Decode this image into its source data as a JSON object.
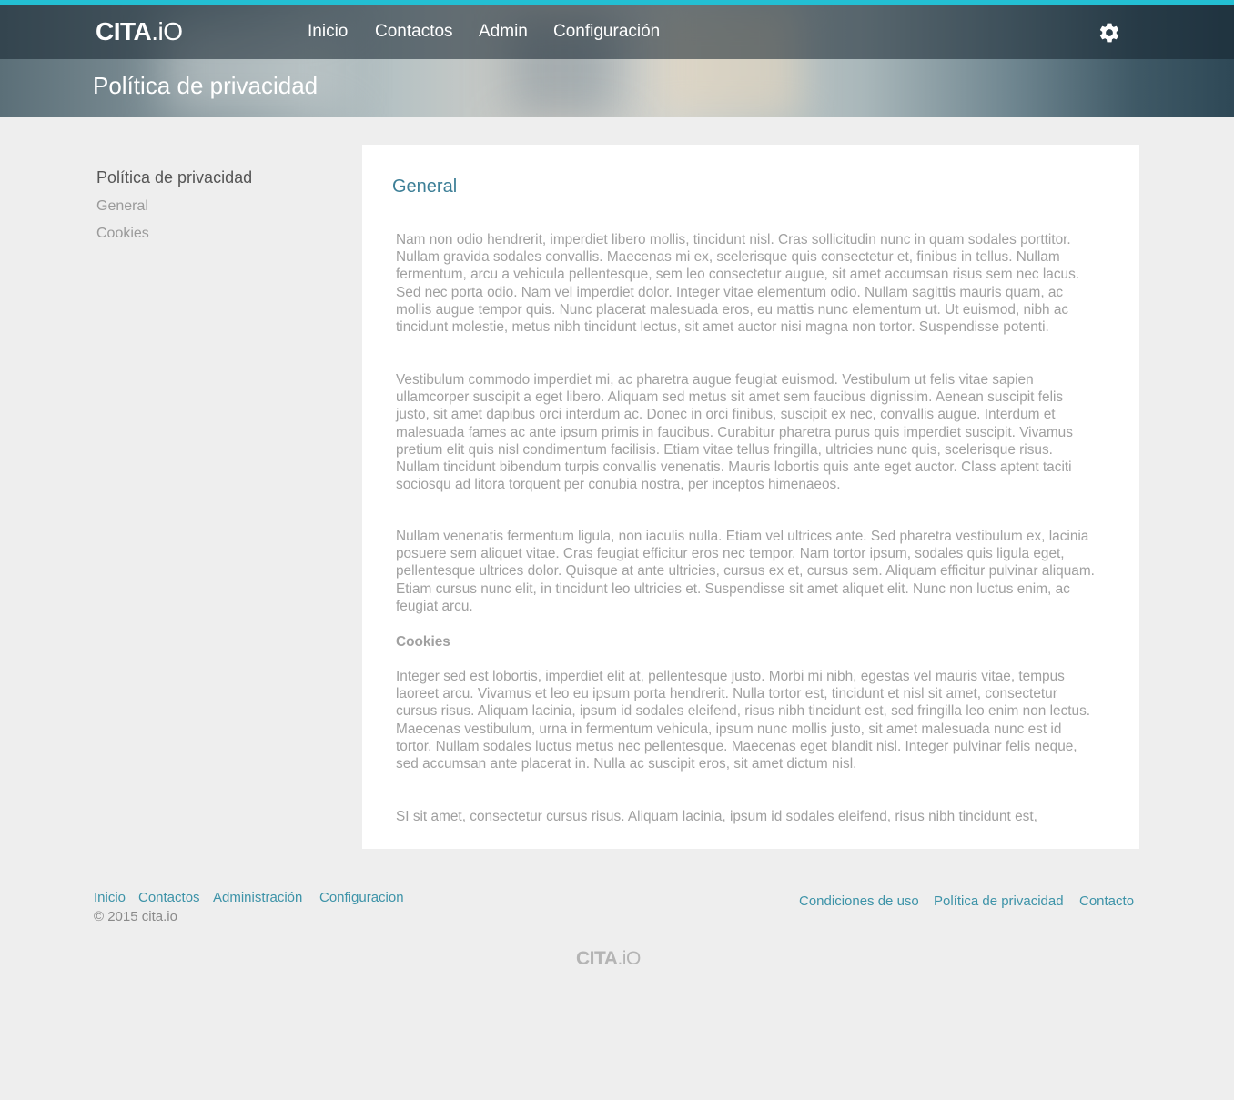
{
  "header": {
    "logo_bold": "CITA",
    "logo_light": ".iO",
    "nav": [
      "Inicio",
      "Contactos",
      "Admin",
      "Configuración"
    ],
    "page_title": "Política de privacidad"
  },
  "sidebar": {
    "title": "Política de privacidad",
    "links": [
      "General",
      "Cookies"
    ]
  },
  "content": {
    "heading": "General",
    "paragraphs": [
      "Nam non odio hendrerit, imperdiet libero mollis, tincidunt nisl. Cras sollicitudin nunc in quam sodales porttitor. Nullam gravida sodales convallis. Maecenas mi ex, scelerisque quis consectetur et, finibus in tellus. Nullam fermentum, arcu a vehicula pellentesque, sem leo consectetur augue, sit amet accumsan risus sem nec lacus. Sed nec porta odio. Nam vel imperdiet dolor. Integer vitae elementum odio. Nullam sagittis mauris quam, ac mollis augue tempor quis. Nunc placerat malesuada eros, eu mattis nunc elementum ut. Ut euismod, nibh ac tincidunt molestie, metus nibh tincidunt lectus, sit amet auctor nisi magna non tortor. Suspendisse potenti.",
      "Vestibulum commodo imperdiet mi, ac pharetra augue feugiat euismod. Vestibulum ut felis vitae sapien ullamcorper suscipit a eget libero. Aliquam sed metus sit amet sem faucibus dignissim. Aenean suscipit felis justo, sit amet dapibus orci interdum ac. Donec in orci finibus, suscipit ex nec, convallis augue. Interdum et malesuada fames ac ante ipsum primis in faucibus. Curabitur pharetra purus quis imperdiet suscipit. Vivamus pretium elit quis nisl condimentum facilisis. Etiam vitae tellus fringilla, ultricies nunc quis, scelerisque risus. Nullam tincidunt bibendum turpis convallis venenatis. Mauris lobortis quis ante eget auctor. Class aptent taciti sociosqu ad litora torquent per conubia nostra, per inceptos himenaeos.",
      "Nullam venenatis fermentum ligula, non iaculis nulla. Etiam vel ultrices ante. Sed pharetra vestibulum ex, lacinia posuere sem aliquet vitae. Cras feugiat efficitur eros nec tempor. Nam tortor ipsum, sodales quis ligula eget, pellentesque ultrices dolor. Quisque at ante ultricies, cursus ex et, cursus sem. Aliquam efficitur pulvinar aliquam. Etiam cursus nunc elit, in tincidunt leo ultricies et. Suspendisse sit amet aliquet elit. Nunc non luctus enim, ac feugiat arcu."
    ],
    "subheading": "Cookies",
    "cookies_paragraphs": [
      "Integer sed est lobortis, imperdiet elit at, pellentesque justo. Morbi mi nibh, egestas vel mauris vitae, tempus laoreet arcu. Vivamus et leo eu ipsum porta hendrerit. Nulla tortor est, tincidunt et nisl sit amet, consectetur cursus risus. Aliquam lacinia, ipsum id sodales eleifend, risus nibh tincidunt est, sed fringilla leo enim non lectus. Maecenas vestibulum, urna in fermentum vehicula, ipsum nunc mollis justo, sit amet malesuada nunc est id tortor. Nullam sodales luctus metus nec pellentesque. Maecenas eget blandit nisl. Integer pulvinar felis neque, sed accumsan ante placerat in. Nulla ac suscipit eros, sit amet dictum nisl.",
      "SI sit amet, consectetur cursus risus. Aliquam lacinia, ipsum id sodales eleifend, risus nibh tincidunt est,"
    ]
  },
  "footer": {
    "left_links": [
      "Inicio",
      "Contactos",
      "Administración",
      "Configuracion"
    ],
    "copyright": "© 2015 cita.io",
    "right_links": [
      "Condiciones de uso",
      "Política de privacidad",
      "Contacto"
    ],
    "logo_bold": "CITA",
    "logo_light": ".iO"
  },
  "colors": {
    "accent_bar": "#23bfd3",
    "link": "#3d93a8",
    "heading": "#3d7f97",
    "page_bg": "#eeeeee"
  },
  "icons": [
    "gear-icon"
  ]
}
